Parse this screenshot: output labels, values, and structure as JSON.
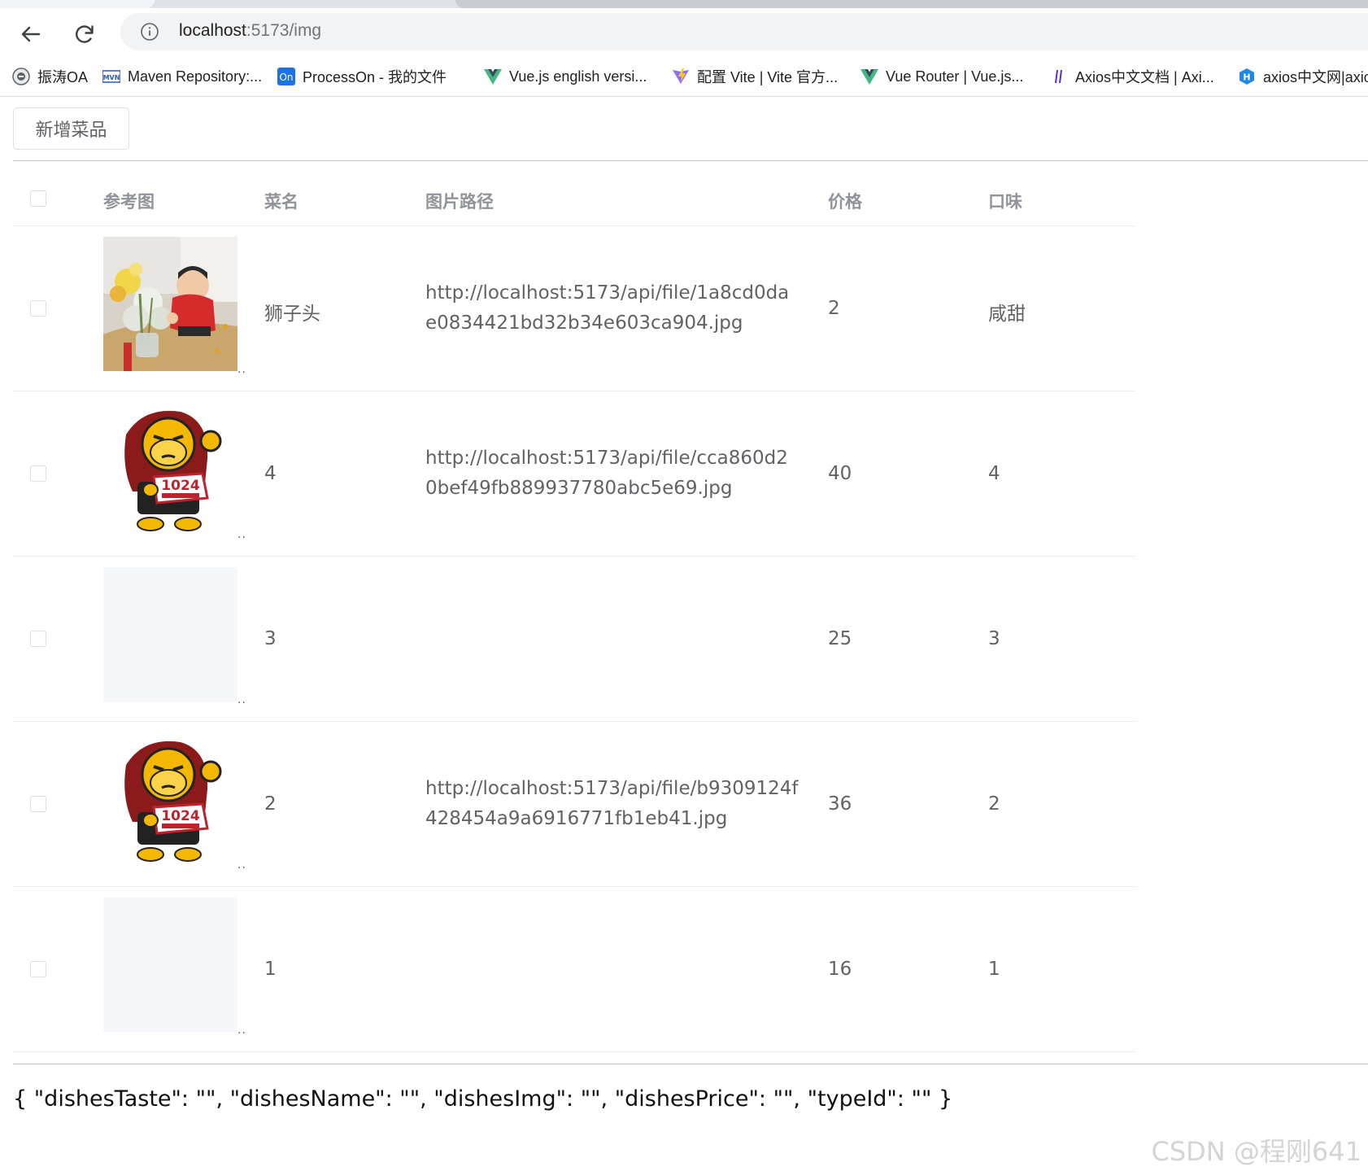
{
  "browser": {
    "url_host": "localhost",
    "url_rest": ":5173/img",
    "bookmarks": [
      {
        "label": "振涛OA",
        "icon": "oa-icon"
      },
      {
        "label": "Maven Repository:...",
        "icon": "maven-icon"
      },
      {
        "label": "ProcessOn - 我的文件",
        "icon": "processon-icon"
      },
      {
        "label": "Vue.js english  versi...",
        "icon": "vue-icon"
      },
      {
        "label": "配置 Vite | Vite 官方...",
        "icon": "vite-icon"
      },
      {
        "label": "Vue Router | Vue.js...",
        "icon": "vue-icon"
      },
      {
        "label": "Axios中文文档 | Axi...",
        "icon": "axios-icon"
      },
      {
        "label": "axios中文网|axios",
        "icon": "h-icon"
      }
    ]
  },
  "page": {
    "add_button": "新增菜品",
    "columns": {
      "check": "",
      "image": "参考图",
      "name": "菜名",
      "path": "图片路径",
      "price": "价格",
      "taste": "口味"
    },
    "rows": [
      {
        "image": "photo",
        "overflow": "..",
        "name": "狮子头",
        "path": "http://localhost:5173/api/file/1a8cd0dae0834421bd32b34e603ca904.jpg",
        "price": "2",
        "taste": "咸甜"
      },
      {
        "image": "mascot",
        "overflow": "..",
        "name": "4",
        "path": "http://localhost:5173/api/file/cca860d20bef49fb889937780abc5e69.jpg",
        "price": "40",
        "taste": "4"
      },
      {
        "image": "empty",
        "overflow": "..",
        "name": "3",
        "path": "",
        "price": "25",
        "taste": "3"
      },
      {
        "image": "mascot",
        "overflow": "..",
        "name": "2",
        "path": "http://localhost:5173/api/file/b9309124f428454a9a6916771fb1eb41.jpg",
        "price": "36",
        "taste": "2"
      },
      {
        "image": "empty",
        "overflow": "..",
        "name": "1",
        "path": "",
        "price": "16",
        "taste": "1"
      }
    ],
    "form_json": "{ \"dishesTaste\": \"\", \"dishesName\": \"\", \"dishesImg\": \"\", \"dishesPrice\": \"\", \"typeId\": \"\" }",
    "watermark": "CSDN @程刚641"
  },
  "colors": {
    "header_text": "#909399",
    "cell_text": "#606266",
    "border": "#ebeef5",
    "placeholder_bg": "#f5f7fa"
  }
}
